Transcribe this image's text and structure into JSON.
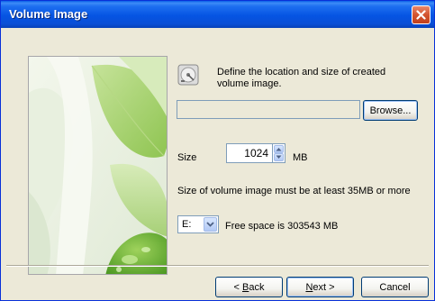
{
  "window": {
    "title": "Volume Image"
  },
  "description": "Define the location and size of created volume image.",
  "location": {
    "value": "",
    "browse_label": "Browse..."
  },
  "size": {
    "label": "Size",
    "value": "1024",
    "unit": "MB"
  },
  "note": "Size of volume image must be at least 35MB or more",
  "drive": {
    "selected": "E:",
    "free_space": "Free space is 303543 MB"
  },
  "buttons": {
    "back_mnemonic": "B",
    "back_rest": "ack",
    "next_mnemonic": "N",
    "next_rest": "ext",
    "cancel": "Cancel"
  },
  "icons": {
    "close": "close-icon",
    "disk": "hard-disk-icon",
    "spin_up": "arrow-up-icon",
    "spin_down": "arrow-down-icon",
    "dropdown": "chevron-down-icon",
    "back_arrow": "chevron-left-icon",
    "next_arrow": "chevron-right-icon"
  },
  "colors": {
    "titlebar": "#0554e3",
    "close_button": "#d3542f",
    "dialog_background": "#ece9d8",
    "input_border": "#7f9db9"
  }
}
